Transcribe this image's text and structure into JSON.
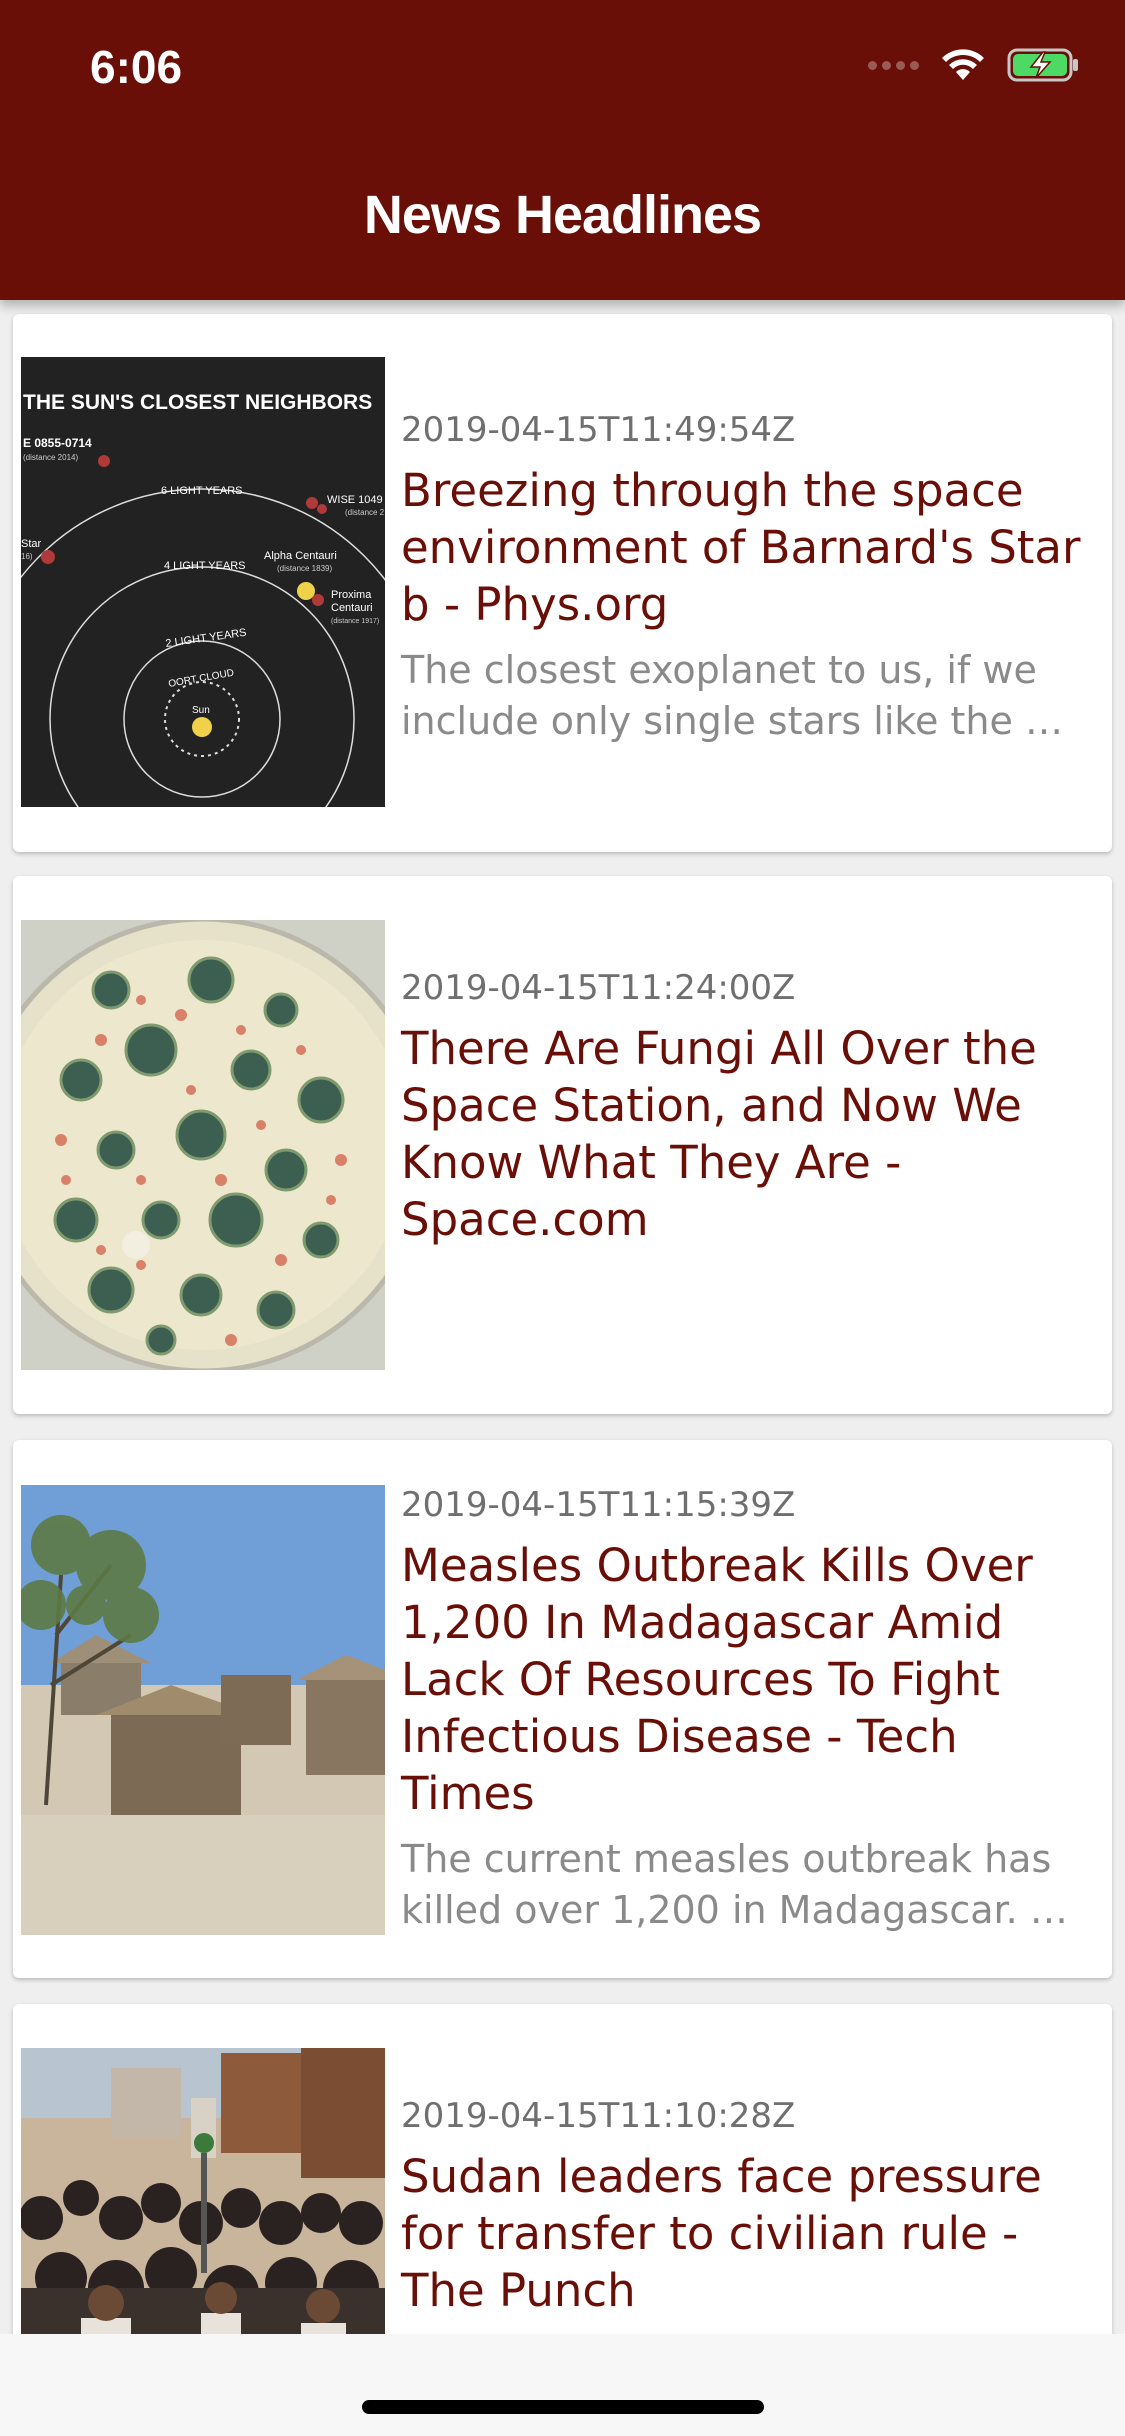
{
  "status_bar": {
    "time": "6:06"
  },
  "header": {
    "title": "News Headlines"
  },
  "colors": {
    "header_bg": "#6a0f08",
    "title_text": "#6a0f08",
    "date_text": "#6f6f6f",
    "description_text": "#8a8a8a"
  },
  "articles": [
    {
      "date": "2019-04-15T11:49:54Z",
      "title": "Breezing through the space environment of Barnard's Star b - Phys.org",
      "description": "The closest exoplanet to us, if we include only single stars like the …",
      "image": {
        "heading": "THE SUN'S CLOSEST NEIGHBORS",
        "labels": {
          "star_a": "E 0855-0714",
          "star_a_note": "(distance 2014)",
          "ring6": "6 LIGHT YEARS",
          "wise": "WISE 1049",
          "wise_note": "(distance 2",
          "star_edge": "Star",
          "star_edge_note": "16)",
          "ring4": "4 LIGHT YEARS",
          "alpha": "Alpha Centauri",
          "alpha_note": "(distance 1839)",
          "proxima": "Proxima",
          "centauri": "Centauri",
          "proxima_note": "(distance 1917)",
          "ring2": "2 LIGHT YEARS",
          "oort": "OORT CLOUD",
          "sun": "Sun"
        }
      }
    },
    {
      "date": "2019-04-15T11:24:00Z",
      "title": "There Are Fungi All Over the Space Station, and Now We Know What They Are - Space.com",
      "description": ""
    },
    {
      "date": "2019-04-15T11:15:39Z",
      "title": "Measles Outbreak Kills Over 1,200 In Madagascar Amid Lack Of Resources To Fight Infectious Disease - Tech Times",
      "description": "The current measles outbreak has killed over 1,200 in Madagascar. …"
    },
    {
      "date": "2019-04-15T11:10:28Z",
      "title": "Sudan leaders face pressure for transfer to civilian rule - The Punch",
      "description": ""
    }
  ]
}
